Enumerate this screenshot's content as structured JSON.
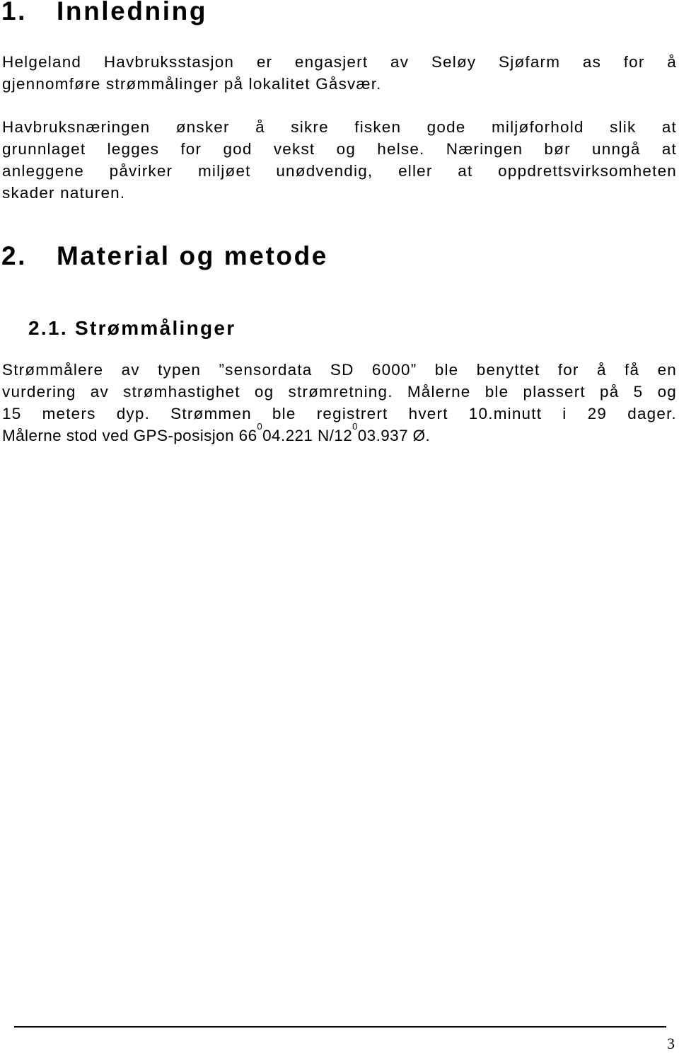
{
  "sections": {
    "intro": {
      "number": "1.",
      "title": "Innledning"
    },
    "method": {
      "number": "2.",
      "title": "Material og metode"
    },
    "current_measurements": {
      "number": "2.1.",
      "title": "Strømmålinger"
    }
  },
  "paragraphs": {
    "p1": {
      "lines": [
        "Helgeland Havbruksstasjon er engasjert av Seløy Sjøfarm as for å",
        "gjennomføre strømmålinger på lokalitet Gåsvær."
      ]
    },
    "p2": {
      "lines": [
        "Havbruksnæringen ønsker å sikre fisken gode miljøforhold slik at",
        "grunnlaget legges for god vekst og helse. Næringen bør unngå at",
        "anleggene påvirker miljøet unødvendig, eller at oppdrettsvirksomheten",
        "skader naturen."
      ]
    },
    "p3": {
      "lines": [
        "Strømmålere av typen ”sensordata SD 6000” ble benyttet for å få en",
        "vurdering av strømhastighet og strømretning. Målerne ble plassert på 5 og",
        "15 meters dyp. Strømmen ble registrert hvert 10.minutt i 29 dager."
      ],
      "gps_line": {
        "prefix": "Målerne stod ved GPS-posisjon 66",
        "lat_sup": "0",
        "lat_rest": "04.221 N/12",
        "lon_sup": "0",
        "lon_rest": "03.937 Ø."
      }
    }
  },
  "footer": {
    "page_number": "3"
  }
}
